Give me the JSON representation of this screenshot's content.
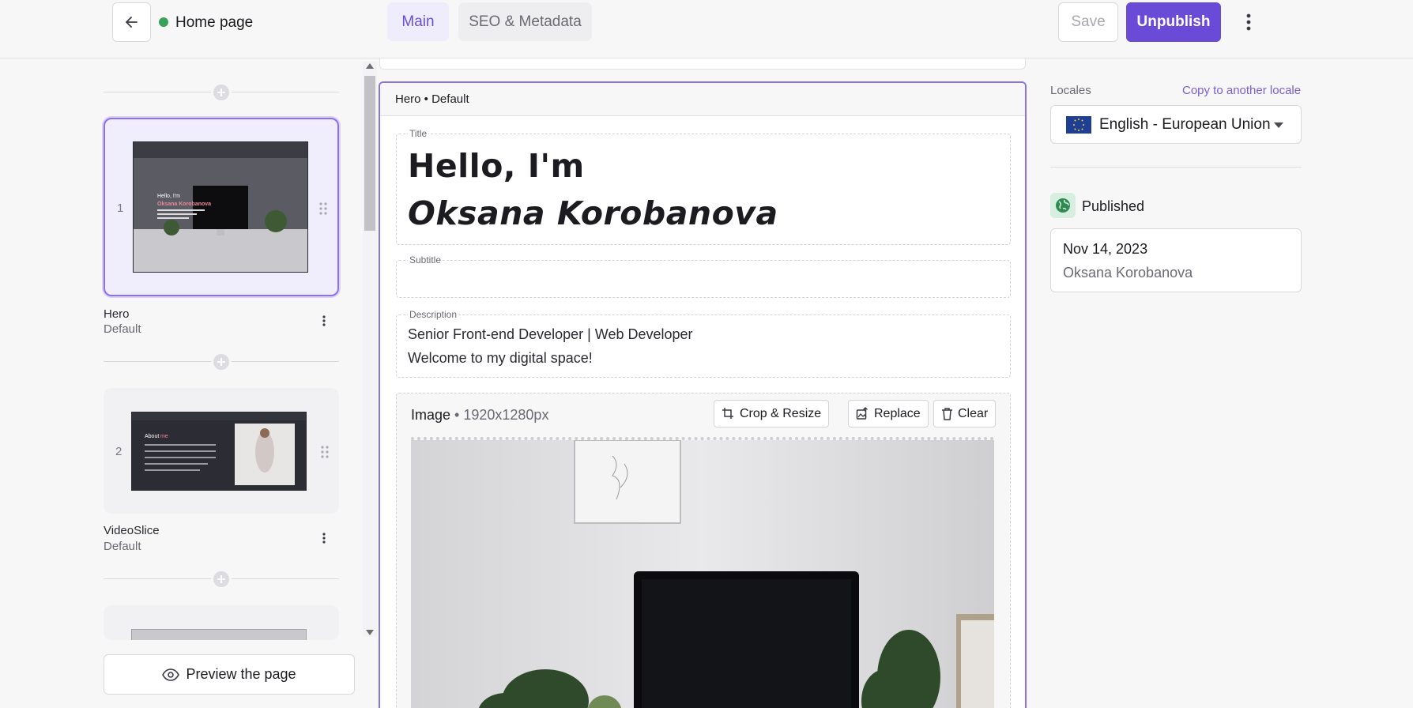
{
  "header": {
    "page_title": "Home page",
    "tabs": [
      {
        "label": "Main",
        "active": true
      },
      {
        "label": "SEO & Metadata",
        "active": false
      }
    ],
    "save_label": "Save",
    "unpublish_label": "Unpublish",
    "status_color": "#3aa15b",
    "accent_color": "#6a4bd8"
  },
  "slices": [
    {
      "number": "1",
      "name": "Hero",
      "variant": "Default",
      "active": true
    },
    {
      "number": "2",
      "name": "VideoSlice",
      "variant": "Default",
      "active": false
    }
  ],
  "preview_label": "Preview the page",
  "editor": {
    "header": "Hero • Default",
    "title_label": "Title",
    "title_line1": "Hello, I'm",
    "title_line2": "Oksana Korobanova",
    "subtitle_label": "Subtitle",
    "subtitle_value": "",
    "description_label": "Description",
    "description_line1": "Senior Front-end Developer | Web Developer",
    "description_line2": "Welcome to my digital space!",
    "image_label": "Image",
    "image_dims": "• 1920x1280px",
    "crop_label": "Crop & Resize",
    "replace_label": "Replace",
    "clear_label": "Clear"
  },
  "sidebar_right": {
    "locales_label": "Locales",
    "copy_locale_label": "Copy to another locale",
    "locale_value": "English - European Union",
    "published_label": "Published",
    "publish_date": "Nov 14, 2023",
    "publish_author": "Oksana Korobanova"
  },
  "thumbnails": {
    "hero_line1": "Hello, I'm",
    "hero_line2": "Oksana Korobanova",
    "about_title_a": "About",
    "about_title_b": "me"
  }
}
